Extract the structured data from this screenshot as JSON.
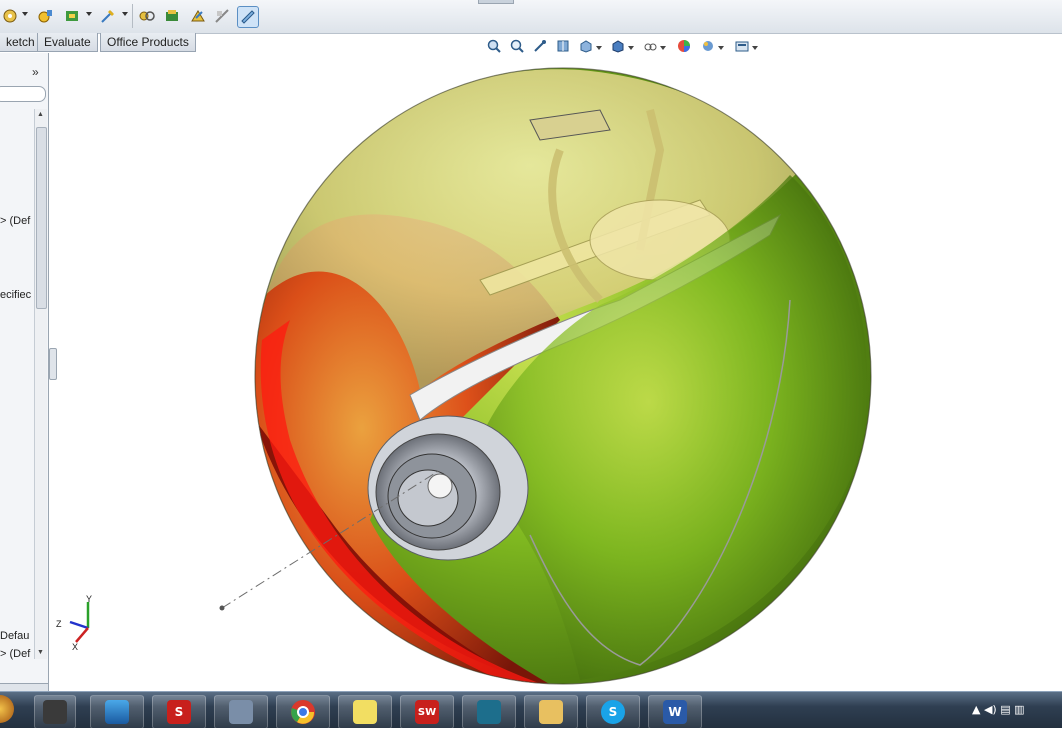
{
  "toolbar": {
    "icons": [
      "rebuild-icon",
      "dropdown-arrow",
      "configure-icon",
      "mate-icon",
      "dropdown-arrow",
      "reference-icon",
      "dropdown-arrow",
      "assembly-icon",
      "assembly-visualization-icon",
      "interference-icon",
      "clearance-icon",
      "measure-icon"
    ]
  },
  "tabs": [
    {
      "label": "ketch"
    },
    {
      "label": "Evaluate"
    },
    {
      "label": "Office Products"
    }
  ],
  "left_panel": {
    "collapse_glyph": "»",
    "tree_rows": [
      {
        "text": "> (Def"
      },
      {
        "text": "ecifiec"
      },
      {
        "text": "Defau"
      },
      {
        "text": "> (Def"
      }
    ],
    "scroll_up": "▲",
    "scroll_down": "▼"
  },
  "view_toolbar": {
    "icons": [
      "zoom-to-fit-icon",
      "zoom-to-area-icon",
      "previous-view-icon",
      "section-view-icon",
      "view-orientation-icon",
      "display-style-icon",
      "hide-show-items-icon",
      "edit-appearance-icon",
      "apply-scene-icon",
      "view-settings-icon"
    ]
  },
  "triad": {
    "z_label": "Z",
    "y_label": "Y",
    "x_label": "X"
  },
  "taskbar": {
    "items": [
      {
        "name": "start-orb",
        "label": ""
      },
      {
        "name": "game-app",
        "label": ""
      },
      {
        "name": "paint-app",
        "label": ""
      },
      {
        "name": "solidworks-3d-app",
        "label": "S"
      },
      {
        "name": "tool-app",
        "label": ""
      },
      {
        "name": "chrome-app",
        "label": ""
      },
      {
        "name": "sticky-notes-app",
        "label": ""
      },
      {
        "name": "solidworks-app",
        "label": "SW"
      },
      {
        "name": "chart-app",
        "label": ""
      },
      {
        "name": "explorer-app",
        "label": ""
      },
      {
        "name": "skype-app",
        "label": "S"
      },
      {
        "name": "word-app",
        "label": "W"
      }
    ],
    "tray": "▲ ◀) ▤ ▥"
  }
}
